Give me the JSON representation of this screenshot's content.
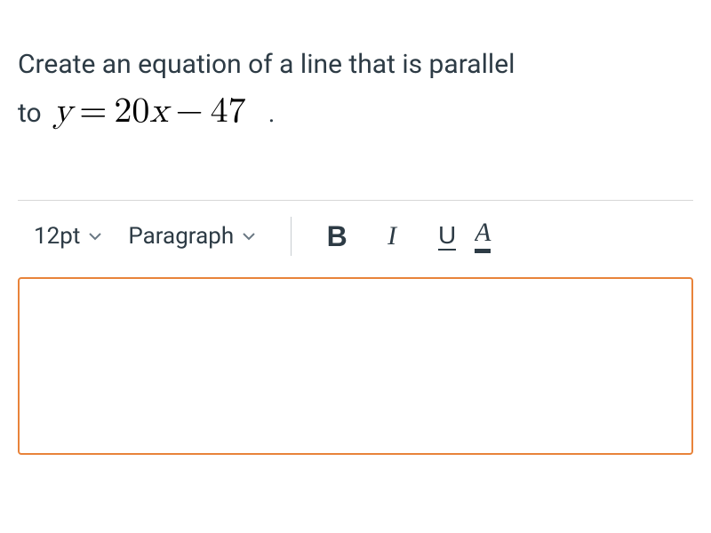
{
  "question": {
    "prefix": "Create an equation of a line that is parallel",
    "continuation": "to",
    "equation_y": "y",
    "equation_eq": "=",
    "equation_coef": "20",
    "equation_x": "x",
    "equation_minus": "−",
    "equation_const": "47",
    "period": "."
  },
  "toolbar": {
    "font_size": "12pt",
    "paragraph": "Paragraph",
    "bold": "B",
    "italic": "I",
    "underline": "U",
    "text_color": "A"
  }
}
